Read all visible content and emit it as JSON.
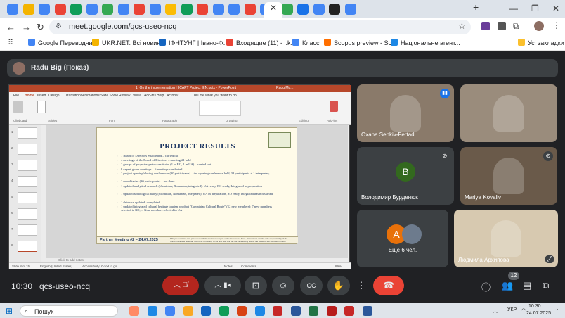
{
  "browser": {
    "url": "meet.google.com/qcs-useo-ncq",
    "tab_colors": [
      "#4285f4",
      "#f4b400",
      "#4285f4",
      "#ea4335",
      "#0f9d58",
      "#4285f4",
      "#34a853",
      "#4285f4",
      "#ea4335",
      "#4285f4",
      "#fbbc04",
      "#0f9d58",
      "#ea4335",
      "#4285f4",
      "#4285f4",
      "#ea4335",
      "#4285f4",
      "#34a853",
      "#1a73e8",
      "#4285f4",
      "#222222",
      "#4285f4"
    ],
    "bookmarks": [
      {
        "label": "Google Переводчик",
        "color": "#4285f4"
      },
      {
        "label": "UKR.NET: Всі новин...",
        "color": "#f4b400"
      },
      {
        "label": "ІФНТУНГ | Івано-Ф...",
        "color": "#1565c0"
      },
      {
        "label": "Входящие (11) - l.k...",
        "color": "#ea4335"
      },
      {
        "label": "Класс",
        "color": "#4285f4"
      },
      {
        "label": "Scopus preview - Sc...",
        "color": "#ff6f00"
      },
      {
        "label": "Національне агент...",
        "color": "#1e88e5"
      }
    ],
    "all_bookmarks": "Усі закладки"
  },
  "meet": {
    "presenter_label": "Radu Big (Показ)",
    "meeting_time": "10:30",
    "meeting_code": "qcs-useo-ncq",
    "people_count": "12",
    "tiles": [
      {
        "name": "Oxana Senkiv-Fertadi",
        "mic": "speaking",
        "photo": "#8a7a6a"
      },
      {
        "name": "",
        "mic": "none",
        "photo": "#9a8c7c"
      },
      {
        "name": "Володимир Бурденюк",
        "mic": "muted",
        "avatar_letter": "В",
        "avatar_color": "#33691e"
      },
      {
        "name": "Mariya Kovaliv",
        "mic": "muted",
        "photo": "#6a5a4a"
      },
      {
        "name": "Ещё 6 чел.",
        "mic": "none",
        "avatar_letter": "A",
        "avatar_color": "#e8710a"
      },
      {
        "name": "Людмила Архипова",
        "mic": "none",
        "photo": "#d7c9b0"
      }
    ]
  },
  "ppt": {
    "title": "1. On the implementation HICAPT Project_EN.pptx - PowerPoint",
    "user": "Radu Mu...",
    "tabs": [
      "File",
      "Home",
      "Insert",
      "Design",
      "Transitions",
      "Animations",
      "Slide Show",
      "Review",
      "View",
      "Add-ins",
      "Help",
      "Acrobat",
      "Tell me what you want to do"
    ],
    "groups": [
      "Clipboard",
      "Slides",
      "Font",
      "Paragraph",
      "Drawing",
      "Editing",
      "Add-ins"
    ],
    "slide_numbers": [
      "1",
      "2",
      "3",
      "4",
      "5",
      "6",
      "7",
      "8"
    ],
    "notes_placeholder": "Click to add notes",
    "status_left": "Slide 8 of 15",
    "status_lang": "English (United States)",
    "status_access": "Accessibility: Good to go",
    "status_notes": "Notes",
    "status_comments": "Comments",
    "zoom": "89%"
  },
  "slide": {
    "title": "PROJECT RESULTS",
    "bullets": [
      "1 Board of Directors established – carried out",
      "4 meetings of the Board of Directors – meeting #1 held",
      "2 groups of project experts constituted (1 in RO, 1 in UA) – carried out",
      "8 expert group meetings – 6 meetings conducted",
      "2 project opening/closing conferences (30 participants) – the opening conference held, 38 participants + 1 interpreter;",
      "2 round tables (30 participants) – not done",
      "1 updated analytical research (Ukrainian, Romanian, integrated): UA ready, RO ready, Integrated in preparation",
      "1 updated sociological study (Ukrainian, Romanian, integrated): UA in preparation, RO ready, integrated has not started",
      "1 database updated: completed",
      "1 updated integrated cultural heritage tourism product \"Carpathian Cultural Route\" (12 new members): 7 new members selected in RO, ... New members selected in UA"
    ],
    "footer_left": "Partner Meeting #2 – 24.07.2025",
    "disclaimer": "This presentation was produced with the financial support of the European Union. Its contents are the sole responsibility of the Ivano-Frankivsk National Technical University of Oil and Gas and do not necessarily reflect the views of the European Union"
  },
  "taskbar": {
    "search_label": "Пошук",
    "lang": "УКР",
    "clock_time": "10:30",
    "clock_date": "24.07.2025",
    "app_colors": [
      "#ff8a65",
      "#1e88e5",
      "#4285f4",
      "#f9a825",
      "#1565c0",
      "#0f9d58",
      "#d84315",
      "#1e88e5",
      "#c62828",
      "#2b579a",
      "#217346",
      "#b71c1c",
      "#c62828",
      "#2b579a"
    ]
  }
}
